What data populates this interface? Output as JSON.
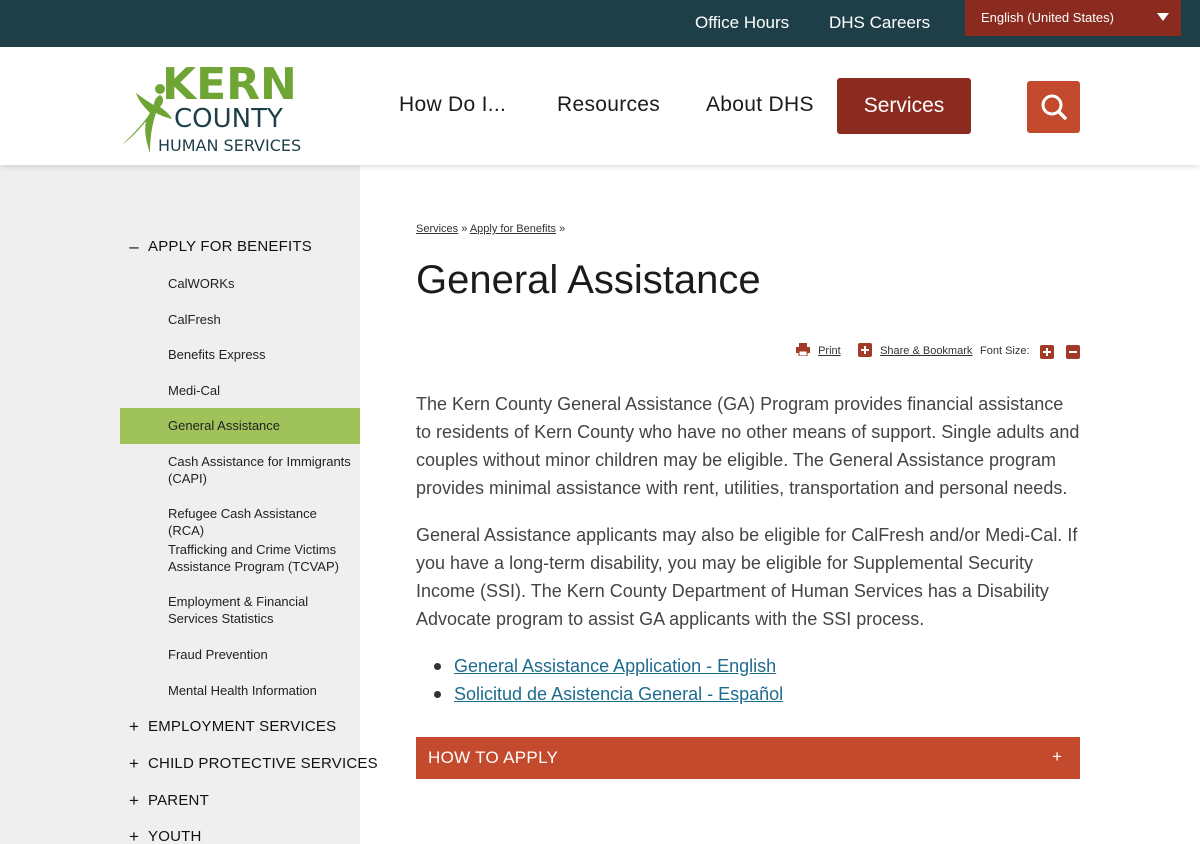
{
  "topbar": {
    "office_hours": "Office Hours",
    "dhs_careers": "DHS Careers",
    "language": "English (United States)"
  },
  "logo": {
    "line1": "KERN",
    "line2": "COUNTY",
    "line3": "HUMAN SERVICES"
  },
  "nav": {
    "how_do_i": "How Do I...",
    "resources": "Resources",
    "about": "About DHS",
    "services": "Services"
  },
  "sidebar": {
    "open_section": "APPLY FOR BENEFITS",
    "items": [
      "CalWORKs",
      "CalFresh",
      "Benefits Express",
      "Medi-Cal",
      "General Assistance",
      "Cash Assistance for Immigrants (CAPI)",
      "Refugee Cash Assistance (RCA)",
      "Trafficking and Crime Victims Assistance Program (TCVAP)",
      "Employment & Financial Services Statistics",
      "Fraud Prevention",
      "Mental Health Information"
    ],
    "sections": [
      "EMPLOYMENT SERVICES",
      "CHILD PROTECTIVE SERVICES",
      "PARENT",
      "YOUTH"
    ],
    "minus": "–",
    "plus": "+"
  },
  "breadcrumb": {
    "services": "Services",
    "apply": "Apply for Benefits",
    "sep": "»"
  },
  "page": {
    "title": "General Assistance",
    "print": "Print",
    "share": "Share & Bookmark",
    "font_size": "Font Size:",
    "para1": "The Kern County General Assistance (GA) Program provides financial assistance to residents of Kern County who have no other means of support. Single adults and couples without minor children may be eligible. The General Assistance program provides minimal assistance with rent, utilities, transportation and personal needs.",
    "para2": "General Assistance applicants may also be eligible for CalFresh and/or Medi-Cal. If you have a long-term disability, you may be eligible for Supplemental Security Income (SSI). The Kern County Department of Human Services has a Disability Advocate program to assist GA applicants with the SSI process.",
    "link1": "General Assistance Application - English",
    "link2": "Solicitud de Asistencia General - Español",
    "accordion": "HOW TO APPLY",
    "accordion_plus": "+"
  },
  "colors": {
    "topbar": "#1f3f48",
    "brand_red": "#8b2a1f",
    "accent_orange": "#c34a2c",
    "sidebar_active": "#9fc35a",
    "logo_green": "#6fa535",
    "link_blue": "#1d6b8f"
  }
}
